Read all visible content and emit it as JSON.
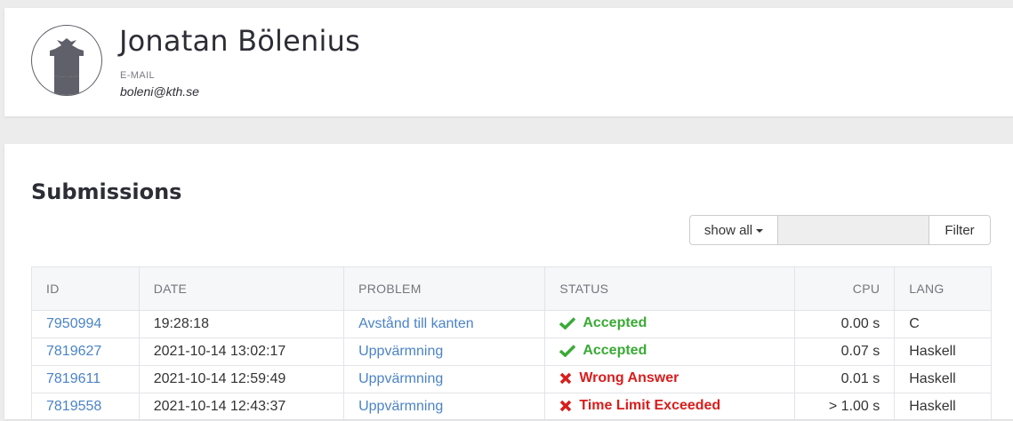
{
  "profile": {
    "name": "Jonatan Bölenius",
    "email_label": "E-MAIL",
    "email": "boleni@kth.se"
  },
  "submissions": {
    "title": "Submissions",
    "show_all_label": "show all",
    "filter_placeholder": "",
    "filter_button": "Filter",
    "columns": [
      "ID",
      "DATE",
      "PROBLEM",
      "STATUS",
      "CPU",
      "LANG"
    ],
    "rows": [
      {
        "id": "7950994",
        "date": "19:28:18",
        "problem": "Avstånd till kanten",
        "status": "Accepted",
        "status_icon": "check-icon",
        "cpu": "0.00 s",
        "lang": "C"
      },
      {
        "id": "7819627",
        "date": "2021-10-14 13:02:17",
        "problem": "Uppvärmning",
        "status": "Accepted",
        "status_icon": "check-icon",
        "cpu": "0.07 s",
        "lang": "Haskell"
      },
      {
        "id": "7819611",
        "date": "2021-10-14 12:59:49",
        "problem": "Uppvärmning",
        "status": "Wrong Answer",
        "status_icon": "cross-icon",
        "cpu": "0.01 s",
        "lang": "Haskell"
      },
      {
        "id": "7819558",
        "date": "2021-10-14 12:43:37",
        "problem": "Uppvärmning",
        "status": "Time Limit Exceeded",
        "status_icon": "cross-icon",
        "cpu": "> 1.00 s",
        "lang": "Haskell"
      }
    ]
  },
  "colors": {
    "accepted": "#3aaa35",
    "rejected": "#d81d1d",
    "link": "#4b83c7"
  }
}
